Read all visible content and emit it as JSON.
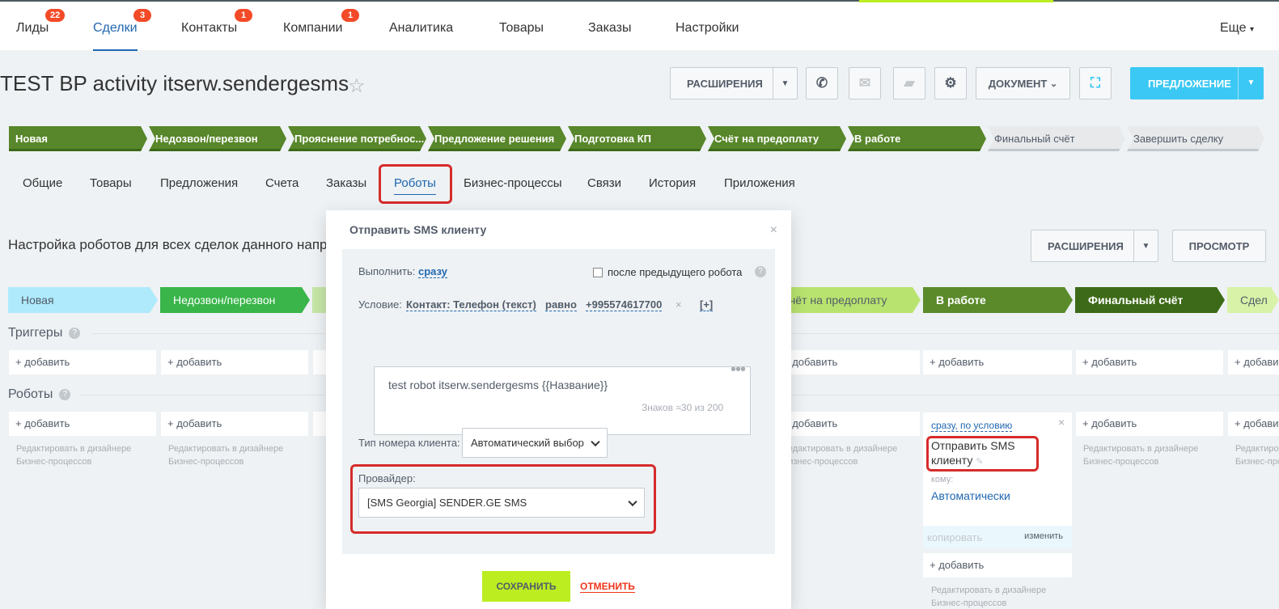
{
  "nav": {
    "items": [
      {
        "label": "Лиды",
        "badge": "22"
      },
      {
        "label": "Сделки",
        "badge": "3"
      },
      {
        "label": "Контакты",
        "badge": "1"
      },
      {
        "label": "Компании",
        "badge": "1"
      },
      {
        "label": "Аналитика"
      },
      {
        "label": "Товары"
      },
      {
        "label": "Заказы"
      },
      {
        "label": "Настройки"
      }
    ],
    "more": "Еще"
  },
  "deal": {
    "title": "TEST BP activity itserw.sendergesms"
  },
  "toolbar": {
    "extensions": "РАСШИРЕНИЯ",
    "document": "ДОКУМЕНТ",
    "propose": "ПРЕДЛОЖЕНИЕ"
  },
  "stages": [
    "Новая",
    "Недозвон/перезвон",
    "Прояснение потребнос...",
    "Предложение решения",
    "Подготовка КП",
    "Счёт на предоплату",
    "В работе",
    "Финальный счёт",
    "Завершить сделку"
  ],
  "tabs": [
    "Общие",
    "Товары",
    "Предложения",
    "Счета",
    "Заказы",
    "Роботы",
    "Бизнес-процессы",
    "Связи",
    "История",
    "Приложения"
  ],
  "robots": {
    "heading": "Настройка роботов для всех сделок данного напра",
    "extensions": "РАСШИРЕНИЯ",
    "preview": "ПРОСМОТР",
    "stages": [
      "Новая",
      "Недозвон/перезвон",
      "чёт на предоплату",
      "В работе",
      "Финальный счёт",
      "Сдел"
    ],
    "triggers_label": "Триггеры",
    "robots_label": "Роботы",
    "add": "+ добавить",
    "hint_line1": "Редактировать в дизайнере",
    "hint_line2": "Бизнес-процессов",
    "card": {
      "condition": "сразу, по условию",
      "title_line1": "Отправить SMS",
      "title_line2": "клиенту",
      "to_label": "кому:",
      "to_value": "Автоматически",
      "copy": "копировать",
      "edit": "изменить"
    }
  },
  "modal": {
    "title": "Отправить SMS клиенту",
    "execute_label": "Выполнить:",
    "execute_value": "сразу",
    "after_prev": "после предыдущего робота",
    "condition_label": "Условие:",
    "condition_field": "Контакт: Телефон (текст)",
    "condition_op": "равно",
    "condition_value": "+995574617700",
    "condition_add": "[+]",
    "message": "test robot itserw.sendergesms {{Название}}",
    "chars_prefix": "Знаков ≈30",
    "chars_of": "из",
    "chars_max": "200",
    "phone_type_label": "Тип номера клиента:",
    "phone_type_value": "Автоматический выбор",
    "provider_label": "Провайдер:",
    "provider_value": "[SMS Georgia] SENDER.GE SMS",
    "save": "СОХРАНИТЬ",
    "cancel": "ОТМЕНИТЬ"
  },
  "colors": {
    "accent": "#2067b0",
    "stage_done": "#58862a",
    "badge": "#f34b27",
    "save": "#bbed21",
    "propose": "#3bc8f5",
    "highlight": "#d72b2b"
  }
}
